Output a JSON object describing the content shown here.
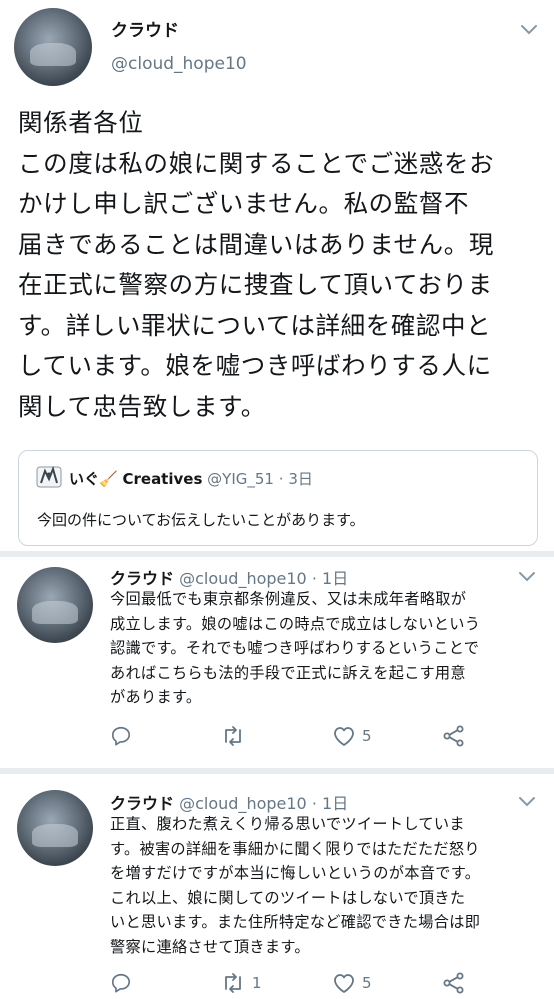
{
  "main": {
    "name": "クラウド",
    "handle": "@cloud_hope10",
    "text": "関係者各位\nこの度は私の娘に関することでご迷惑をお\nかけし申し訳ございません。私の監督不\n届きであることは間違いはありません。現\n在正式に警察の方に捜査して頂いておりま\nす。詳しい罪状については詳細を確認中と\nしています。娘を嘘つき呼ばわりする人に\n関して忠告致します。",
    "quote": {
      "name": "いぐ",
      "emoji": "🧹",
      "name_suffix": "Creatives",
      "handle": "@YIG_51",
      "time": "3日",
      "text": "今回の件についてお伝えしたいことがあります。"
    }
  },
  "replies": [
    {
      "name": "クラウド",
      "handle": "@cloud_hope10",
      "time": "1日",
      "text": "今回最低でも東京都条例違反、又は未成年者略取が\n成立します。娘の嘘はこの時点で成立はしないという\n認識です。それでも嘘つき呼ばわりするということで\nあればこちらも法的手段で正式に訴えを起こす用意\nがあります。",
      "retweets": "",
      "likes": "5"
    },
    {
      "name": "クラウド",
      "handle": "@cloud_hope10",
      "time": "1日",
      "text": "正直、腹わた煮えくり帰る思いでツイートしていま\nす。被害の詳細を事細かに聞く限りではただただ怒り\nを増すだけですが本当に悔しいというのが本音です。\nこれ以上、娘に関してのツイートはしないで頂きた\nいと思います。また住所特定など確認できた場合は即\n警察に連絡させて頂きます。",
      "retweets": "1",
      "likes": "5"
    }
  ],
  "sep": "·",
  "icons": {
    "reply": "reply-icon",
    "retweet": "retweet-icon",
    "like": "heart-icon",
    "share": "share-icon",
    "menu": "chevron-down-icon"
  },
  "colors": {
    "text": "#14171a",
    "muted": "#657786",
    "divider": "#e6ecf0",
    "border": "#ccd6dd"
  }
}
